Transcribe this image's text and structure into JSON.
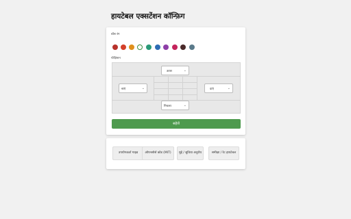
{
  "page_title": "हायटेबल एक्सटेंशन कॉन्फ़िग",
  "color_label": "बॉस रंग",
  "position_label": "पोज़िशन",
  "colors": [
    "#b8322c",
    "#d4402a",
    "#e0901c",
    "#ffffff",
    "#2a9a78",
    "#2d6cb4",
    "#8e3fa8",
    "#c4245c",
    "#4a2a2a",
    "#5a7a8a"
  ],
  "selected_color_index": 3,
  "selects": {
    "top": "ऊपर",
    "left": "बाएं",
    "right": "दाएं",
    "bottom": "निचला"
  },
  "save_label": "सहेजें",
  "links": [
    "उपयोगकर्ता गाइड",
    "ओपनसोर्स कोड (MIT)",
    "मुद्दे / सुविधा अनुरोध",
    "समीक्षा / रेट हायटेबल"
  ]
}
